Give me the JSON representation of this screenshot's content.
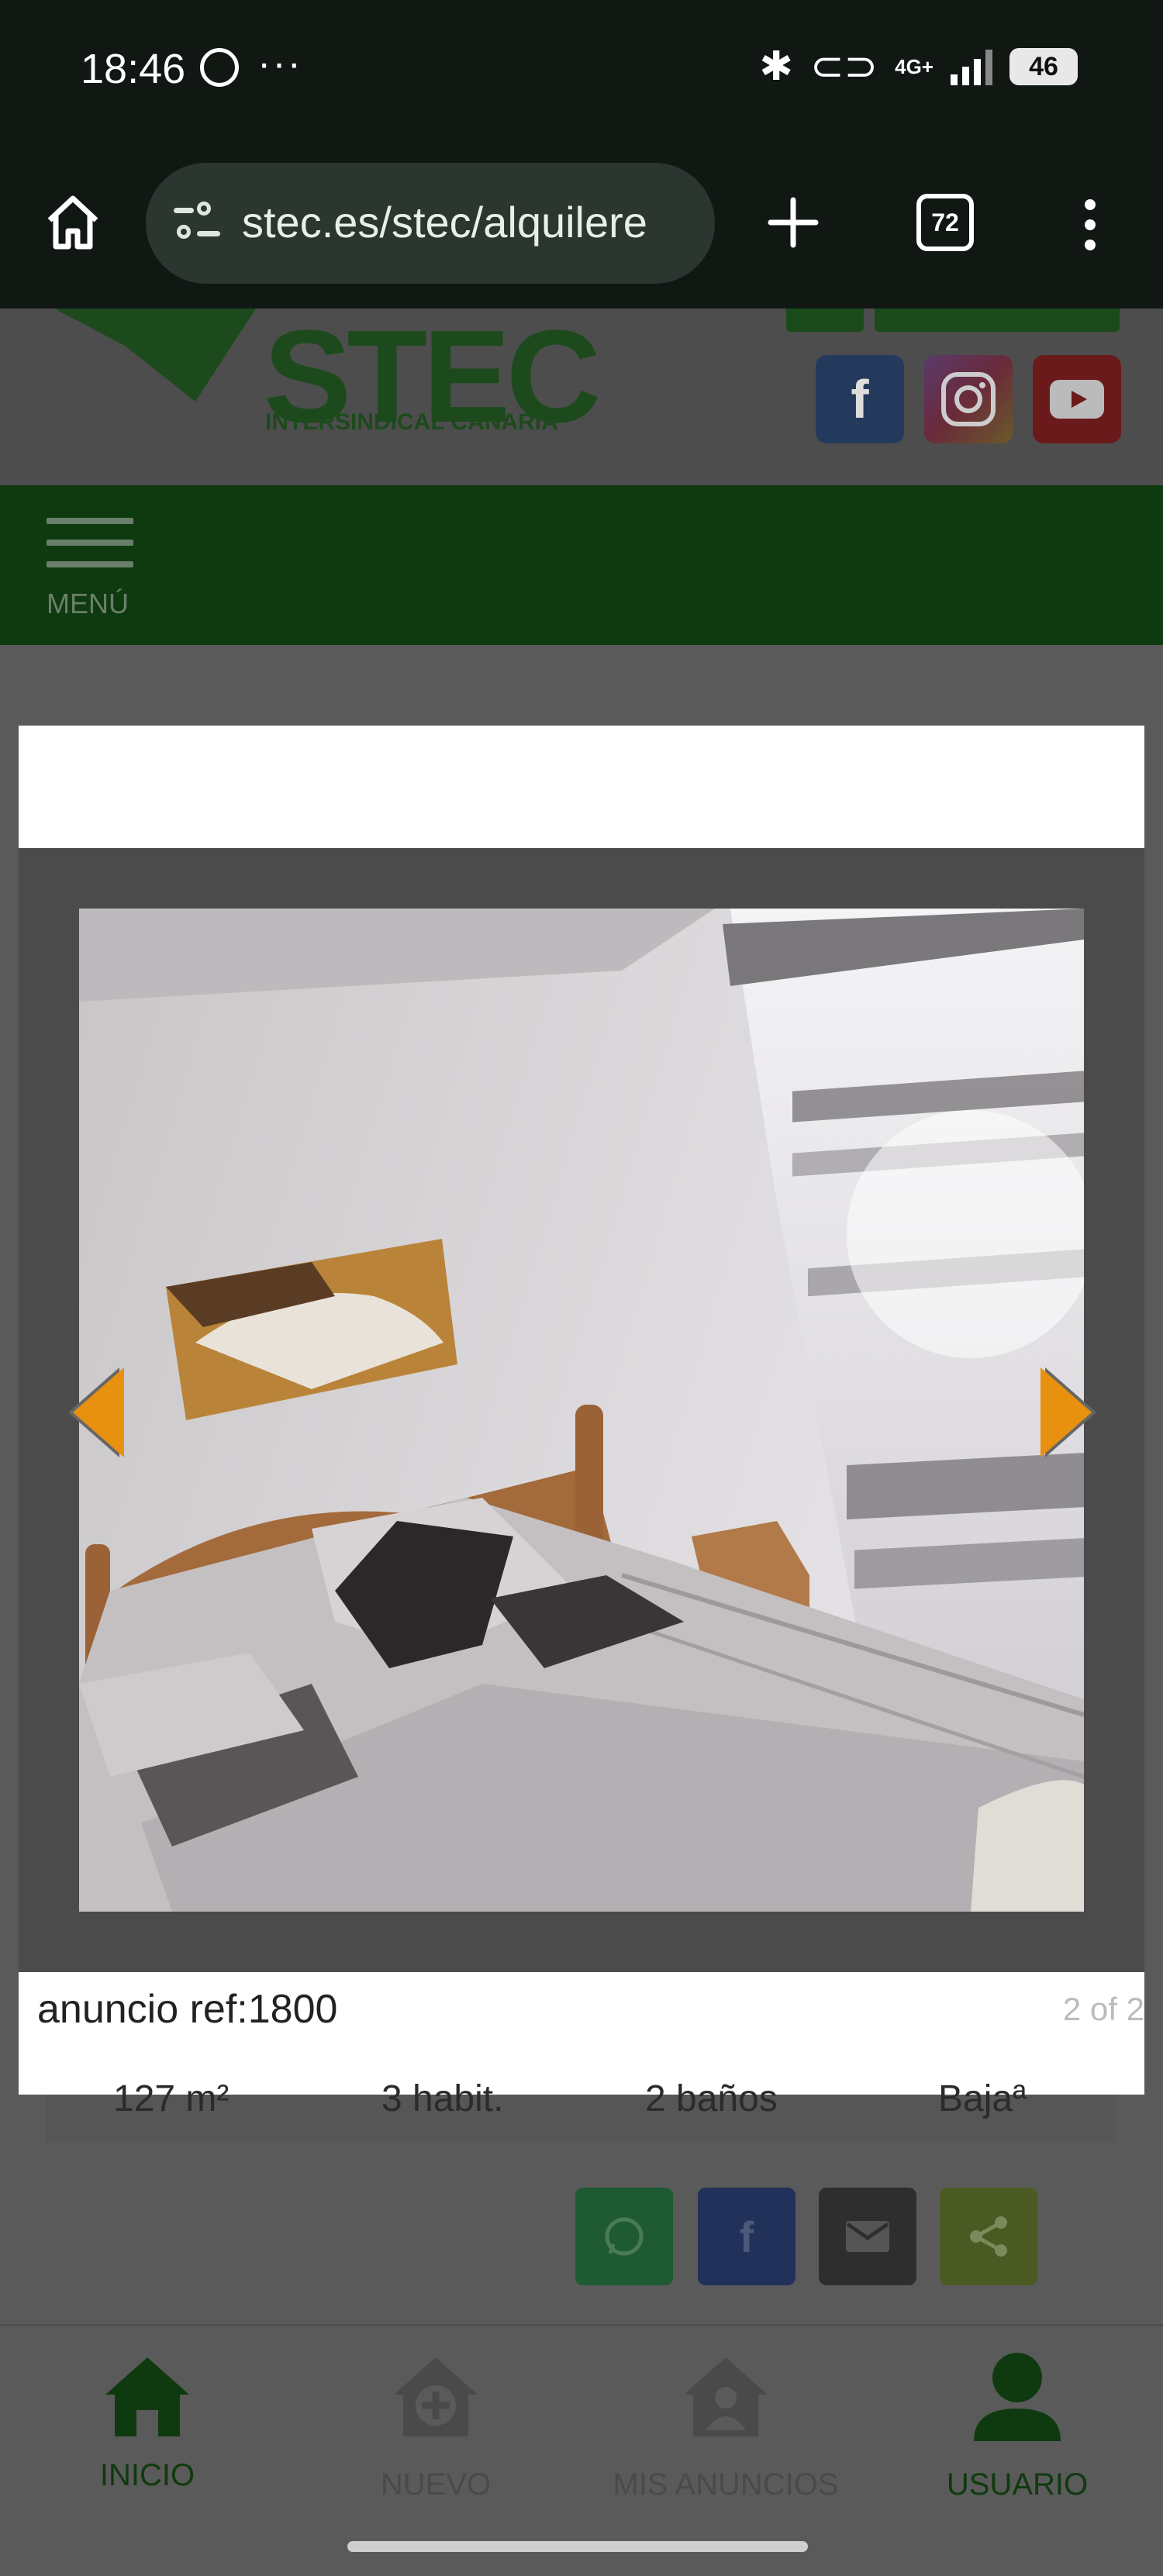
{
  "status_bar": {
    "time": "18:46",
    "battery": "46",
    "network": "4G+",
    "icons": [
      "whatsapp-icon",
      "more-dots-icon",
      "bluetooth-icon",
      "link-icon",
      "signal-icon",
      "battery-icon"
    ]
  },
  "browser": {
    "url": "stec.es/stec/alquilere",
    "tab_count": "72",
    "icons": [
      "home-icon",
      "site-settings-icon",
      "new-tab-icon",
      "tab-switcher-icon",
      "overflow-menu-icon"
    ]
  },
  "site_header": {
    "logo_text": "STEC",
    "logo_subtitle": "INTERSINDICAL CANARIA",
    "social": [
      "facebook-icon",
      "instagram-icon",
      "youtube-icon"
    ]
  },
  "nav": {
    "menu_label": "MENÚ"
  },
  "lightbox": {
    "caption": "anuncio ref:1800",
    "counter": "2 of 2",
    "image_subject": "bedroom photo"
  },
  "listing": {
    "specs": [
      "127 m²",
      "3 habit.",
      "2 baños",
      "Bajaª"
    ]
  },
  "share_buttons": [
    "whatsapp-icon",
    "facebook-icon",
    "email-icon",
    "share-icon"
  ],
  "tab_bar": [
    {
      "label": "INICIO",
      "icon": "home-icon"
    },
    {
      "label": "NUEVO",
      "icon": "add-home-icon"
    },
    {
      "label": "MIS ANUNCIOS",
      "icon": "my-listings-icon"
    },
    {
      "label": "USUARIO",
      "icon": "user-icon"
    }
  ],
  "colors": {
    "brand_green": "#1d4a1d",
    "overlay_gray": "#5a5a5a",
    "arrow_orange": "#e8910f",
    "status_bg": "#111814"
  }
}
